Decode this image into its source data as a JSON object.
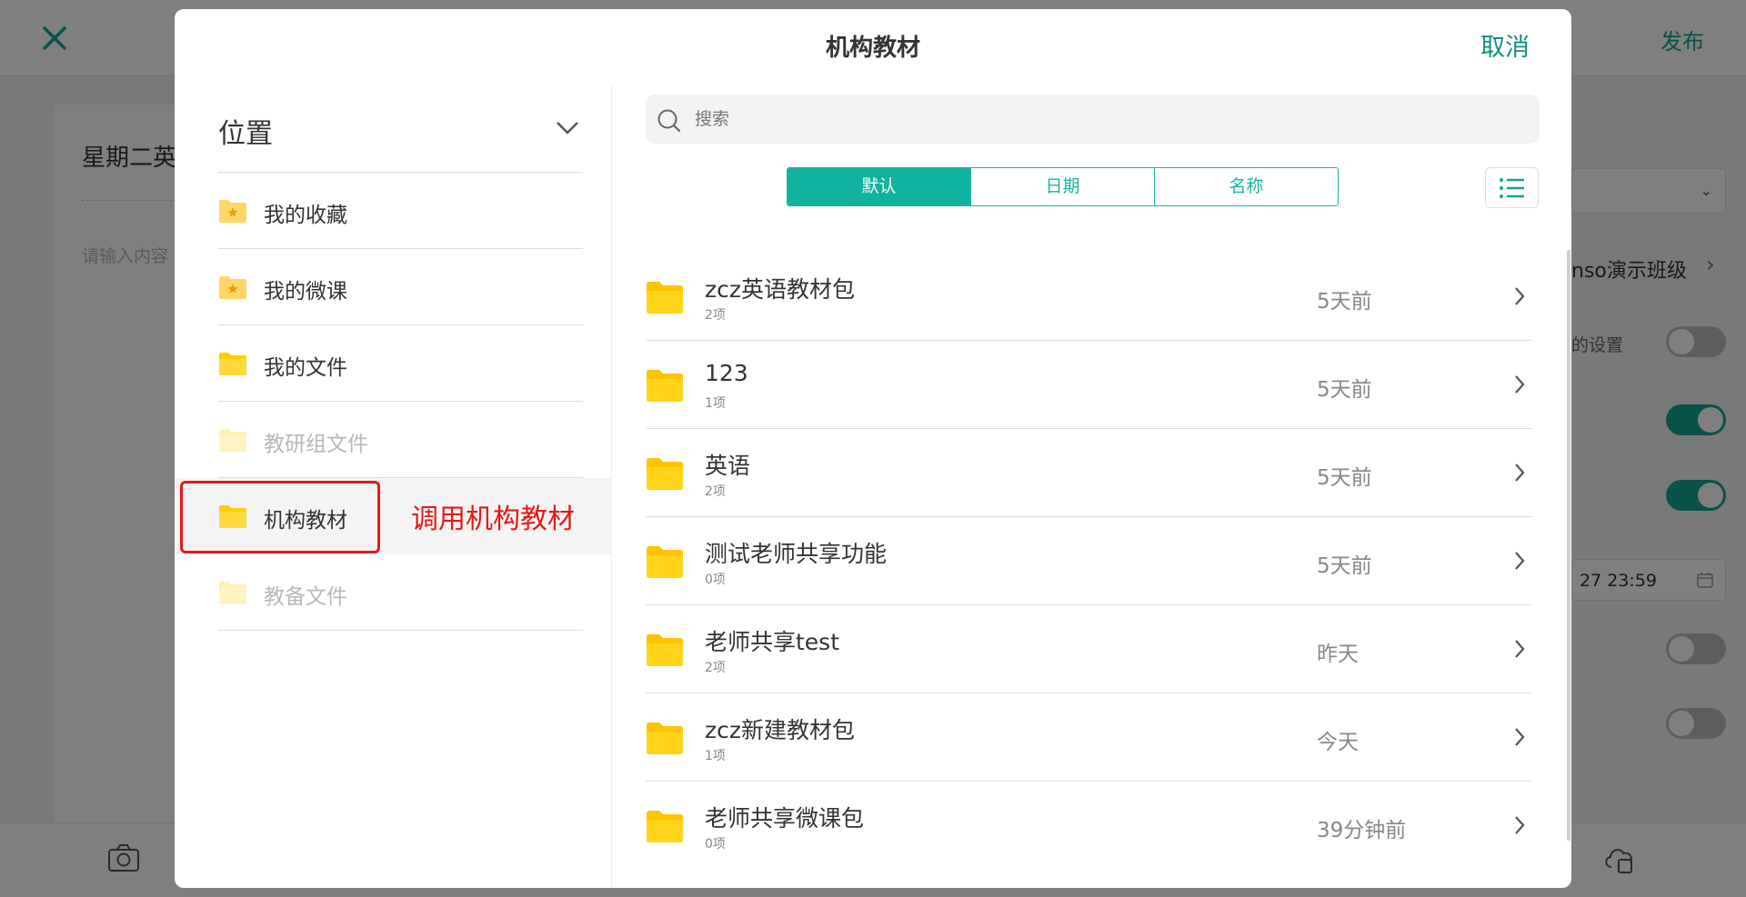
{
  "background": {
    "publish_label": "发布",
    "editor_title": "星期二英",
    "editor_placeholder": "请输入内容",
    "class_name": "nso演示班级",
    "setting_label": "的设置",
    "date_value": "27 23:59"
  },
  "dialog": {
    "title": "机构教材",
    "cancel_label": "取消"
  },
  "location": {
    "header": "位置",
    "items": [
      {
        "label": "我的收藏",
        "icon": "folder-star-icon",
        "state": "normal"
      },
      {
        "label": "我的微课",
        "icon": "folder-star-icon",
        "state": "normal"
      },
      {
        "label": "我的文件",
        "icon": "folder-icon",
        "state": "normal"
      },
      {
        "label": "教研组文件",
        "icon": "folder-icon",
        "state": "disabled"
      },
      {
        "label": "机构教材",
        "icon": "folder-icon",
        "state": "active"
      },
      {
        "label": "教备文件",
        "icon": "folder-icon",
        "state": "disabled"
      }
    ]
  },
  "annotation": {
    "text": "调用机构教材",
    "color": "#e81818"
  },
  "search": {
    "placeholder": "搜索"
  },
  "sort": {
    "tabs": [
      "默认",
      "日期",
      "名称"
    ],
    "active": "默认"
  },
  "files": [
    {
      "name": "zcz英语教材包",
      "count": "2项",
      "date": "5天前"
    },
    {
      "name": "123",
      "count": "1项",
      "date": "5天前"
    },
    {
      "name": "英语",
      "count": "2项",
      "date": "5天前"
    },
    {
      "name": "测试老师共享功能",
      "count": "0项",
      "date": "5天前"
    },
    {
      "name": "老师共享test",
      "count": "2项",
      "date": "昨天"
    },
    {
      "name": "zcz新建教材包",
      "count": "1项",
      "date": "今天"
    },
    {
      "name": "老师共享微课包",
      "count": "0项",
      "date": "39分钟前"
    }
  ],
  "colors": {
    "accent": "#12b39e",
    "folder": "#ffcf00",
    "annotation": "#e81818"
  }
}
